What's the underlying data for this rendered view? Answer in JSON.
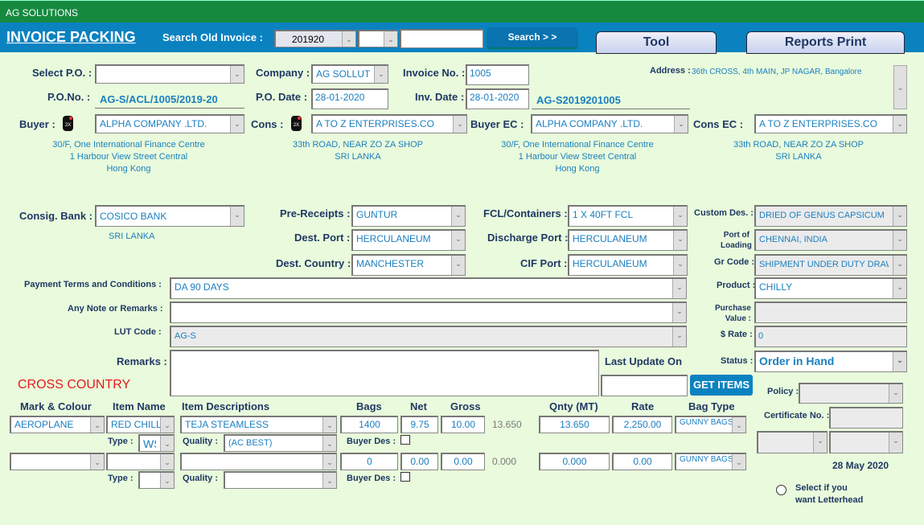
{
  "app": {
    "title": "AG SOLUTIONS"
  },
  "header": {
    "page_title": "INVOICE PACKING",
    "search_label": "Search Old Invoice :",
    "search_year": "201920",
    "search_second": "",
    "search_text": "",
    "search_button": "Search > >",
    "tool_button": "Tool",
    "reports_button": "Reports Print"
  },
  "top": {
    "select_po_label": "Select P.O. :",
    "select_po_value": "",
    "po_no_label": "P.O.No. :",
    "po_no_value": "AG-S/ACL/1005/2019-20",
    "company_label": "Company :",
    "company_value": "AG SOLLUTIO",
    "po_date_label": "P.O. Date :",
    "po_date_value": "28-01-2020",
    "invoice_no_label": "Invoice No. :",
    "invoice_no_value": "1005",
    "inv_date_label": "Inv. Date :",
    "inv_date_value": "28-01-2020",
    "invoice_code": "AG-S2019201005",
    "address_label": "Address :",
    "address_value": "36th CROSS, 4th MAIN, JP NAGAR, Bangalore"
  },
  "parties": {
    "buyer_label": "Buyer :",
    "buyer_value": "ALPHA COMPANY .LTD.",
    "buyer_address": [
      "30/F, One International Finance Centre",
      "1 Harbour View Street Central",
      "Hong Kong"
    ],
    "cons_label": "Cons :",
    "cons_value": "A TO Z ENTERPRISES.CO",
    "cons_address": [
      "33th ROAD, NEAR ZO ZA SHOP",
      "SRI LANKA"
    ],
    "buyer_ec_label": "Buyer EC :",
    "buyer_ec_value": "ALPHA COMPANY .LTD.",
    "buyer_ec_address": [
      "30/F, One International Finance Centre",
      "1 Harbour View Street Central",
      "Hong Kong"
    ],
    "cons_ec_label": "Cons EC :",
    "cons_ec_value": "A TO Z ENTERPRISES.CO",
    "cons_ec_address": [
      "33th ROAD, NEAR ZO ZA SHOP",
      "SRI LANKA"
    ],
    "icon_text": "2X"
  },
  "shipping": {
    "consig_bank_label": "Consig. Bank :",
    "consig_bank_value": "COSICO BANK",
    "consig_bank_country": "SRI LANKA",
    "pre_receipts_label": "Pre-Receipts :",
    "pre_receipts_value": "GUNTUR",
    "dest_port_label": "Dest. Port :",
    "dest_port_value": "HERCULANEUM",
    "dest_country_label": "Dest. Country :",
    "dest_country_value": "MANCHESTER",
    "fcl_label": "FCL/Containers :",
    "fcl_value": "1 X 40FT FCL",
    "discharge_label": "Discharge Port :",
    "discharge_value": "HERCULANEUM",
    "cif_label": "CIF Port :",
    "cif_value": "HERCULANEUM",
    "custom_des_label": "Custom Des. :",
    "custom_des_value": "DRIED OF GENUS CAPSICUM",
    "port_loading_label_1": "Port of",
    "port_loading_label_2": "Loading :",
    "port_loading_value": "CHENNAI, INDIA",
    "gr_code_label": "Gr Code :",
    "gr_code_value": "SHIPMENT UNDER DUTY DRAW"
  },
  "terms": {
    "payment_label": "Payment Terms and Conditions :",
    "payment_value": "DA 90 DAYS",
    "note_label": "Any Note or Remarks :",
    "note_value": "",
    "lut_label": "LUT Code :",
    "lut_value": "AG-S",
    "remarks_label": "Remarks :",
    "remarks_value": "",
    "cross_country": "CROSS COUNTRY",
    "last_update_label": "Last Update On",
    "last_update_value": "",
    "get_items": "GET ITEMS"
  },
  "side": {
    "product_label": "Product :",
    "product_value": "CHILLY",
    "purchase_label_1": "Purchase",
    "purchase_label_2": "Value :",
    "purchase_value": "",
    "rate_label": "$ Rate :",
    "rate_value": "0",
    "status_label": "Status :",
    "status_value": "Order in Hand",
    "policy_label": "Policy :",
    "policy_value": "",
    "certificate_label": "Certificate No. :",
    "certificate_value": "",
    "extra_select_1": "",
    "extra_select_2": "",
    "date": "28 May 2020",
    "letterhead_1": "Select if you",
    "letterhead_2": "want Letterhead"
  },
  "items": {
    "headers": {
      "mark": "Mark & Colour",
      "item_name": "Item Name",
      "desc": "Item Descriptions",
      "bags": "Bags",
      "net": "Net",
      "gross": "Gross",
      "qnty": "Qnty (MT)",
      "rate": "Rate",
      "bag_type": "Bag Type"
    },
    "type_label": "Type :",
    "quality_label": "Quality :",
    "buyer_des_label": "Buyer Des :",
    "rows": [
      {
        "mark": "AEROPLANE",
        "item_name": "RED CHILLY",
        "desc": "TEJA STEAMLESS",
        "bags": "1400",
        "net": "9.75",
        "gross": "10.00",
        "calc": "13.650",
        "qnty": "13.650",
        "rate": "2,250.00",
        "bag_type": "GUNNY BAGS",
        "type": "WS",
        "quality": "(AC BEST)",
        "buyer_des": false
      },
      {
        "mark": "",
        "item_name": "",
        "desc": "",
        "bags": "0",
        "net": "0.00",
        "gross": "0.00",
        "calc": "0.000",
        "qnty": "0.000",
        "rate": "0.00",
        "bag_type": "GUNNY BAGS",
        "type": "",
        "quality": "",
        "buyer_des": false
      }
    ]
  }
}
